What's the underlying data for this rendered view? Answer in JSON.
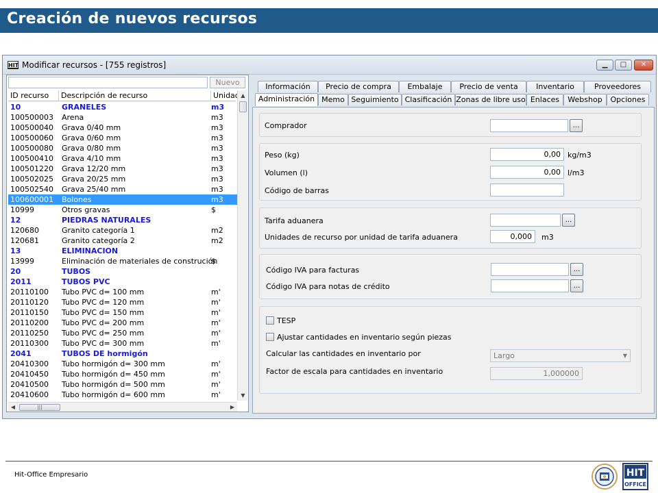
{
  "slide": {
    "title": "Creación de nuevos recursos"
  },
  "window": {
    "title": "Modificar recursos - [755 registros]",
    "app_icon": "HIT",
    "controls": {
      "minimize_icon": "minimize-icon",
      "maximize_icon": "maximize-icon",
      "close_icon": "close-icon"
    }
  },
  "list": {
    "search_value": "",
    "nuevo_label": "Nuevo",
    "headers": [
      "ID recurso",
      "Descripción de recurso",
      "Unidad"
    ],
    "rows": [
      {
        "id": "10",
        "desc": "GRANELES",
        "unit": "m3",
        "group": true
      },
      {
        "id": "100500003",
        "desc": "Arena",
        "unit": "m3"
      },
      {
        "id": "100500040",
        "desc": "Grava 0/40 mm",
        "unit": "m3"
      },
      {
        "id": "100500060",
        "desc": "Grava 0/60 mm",
        "unit": "m3"
      },
      {
        "id": "100500080",
        "desc": "Grava 0/80 mm",
        "unit": "m3"
      },
      {
        "id": "100500410",
        "desc": "Grava 4/10 mm",
        "unit": "m3"
      },
      {
        "id": "100501220",
        "desc": "Grava 12/20 mm",
        "unit": "m3"
      },
      {
        "id": "100502025",
        "desc": "Grava 20/25 mm",
        "unit": "m3"
      },
      {
        "id": "100502540",
        "desc": "Grava 25/40 mm",
        "unit": "m3"
      },
      {
        "id": "100600001",
        "desc": "Bolones",
        "unit": "m3",
        "selected": true
      },
      {
        "id": "10999",
        "desc": "Otros gravas",
        "unit": "$"
      },
      {
        "id": "12",
        "desc": "PIEDRAS NATURALES",
        "unit": "",
        "group": true
      },
      {
        "id": "120680",
        "desc": "Granito categoría 1",
        "unit": "m2"
      },
      {
        "id": "120681",
        "desc": "Granito categoría 2",
        "unit": "m2"
      },
      {
        "id": "13",
        "desc": "ELIMINACION",
        "unit": "",
        "group": true
      },
      {
        "id": "13999",
        "desc": "Eliminación de materiales de construción",
        "unit": "$"
      },
      {
        "id": "20",
        "desc": "TUBOS",
        "unit": "",
        "group": true
      },
      {
        "id": "2011",
        "desc": "TUBOS PVC",
        "unit": "",
        "group": true
      },
      {
        "id": "20110100",
        "desc": "Tubo PVC  d= 100 mm",
        "unit": "m'"
      },
      {
        "id": "20110120",
        "desc": "Tubo PVC  d= 120 mm",
        "unit": "m'"
      },
      {
        "id": "20110150",
        "desc": "Tubo PVC  d= 150 mm",
        "unit": "m'"
      },
      {
        "id": "20110200",
        "desc": "Tubo PVC  d= 200 mm",
        "unit": "m'"
      },
      {
        "id": "20110250",
        "desc": "Tubo PVC  d= 250 mm",
        "unit": "m'"
      },
      {
        "id": "20110300",
        "desc": "Tubo PVC  d= 300 mm",
        "unit": "m'"
      },
      {
        "id": "2041",
        "desc": "TUBOS DE hormigón",
        "unit": "",
        "group": true
      },
      {
        "id": "20410300",
        "desc": "Tubo hormigón  d= 300 mm",
        "unit": "m'"
      },
      {
        "id": "20410450",
        "desc": "Tubo hormigón  d= 450 mm",
        "unit": "m'"
      },
      {
        "id": "20410500",
        "desc": "Tubo hormigón  d= 500 mm",
        "unit": "m'"
      },
      {
        "id": "20410600",
        "desc": "Tubo hormigón  d= 600 mm",
        "unit": "m'"
      }
    ]
  },
  "tabs": {
    "row1": [
      "Información",
      "Precio de compra",
      "Embalaje",
      "Precio de venta",
      "Inventario",
      "Proveedores"
    ],
    "row2": [
      "Administración",
      "Memo",
      "Seguimiento",
      "Clasificación",
      "Zonas de libre uso",
      "Enlaces",
      "Webshop",
      "Opciones"
    ],
    "active": "Administración"
  },
  "form": {
    "comprador": {
      "label": "Comprador",
      "value": ""
    },
    "peso": {
      "label": "Peso (kg)",
      "value": "0,00",
      "unit": "kg/m3"
    },
    "volumen": {
      "label": "Volumen (l)",
      "value": "0,00",
      "unit": "l/m3"
    },
    "codigo_barras": {
      "label": "Código de barras",
      "value": ""
    },
    "tarifa_aduanera": {
      "label": "Tarifa aduanera",
      "value": ""
    },
    "unidades_tarifa": {
      "label": "Unidades de recurso por unidad de tarifa aduanera",
      "value": "0,000",
      "unit": "m3"
    },
    "iva_facturas": {
      "label": "Código IVA para facturas",
      "value": ""
    },
    "iva_notas": {
      "label": "Código IVA para notas de crédito",
      "value": ""
    },
    "tesp": {
      "label": "TESP",
      "checked": false
    },
    "ajustar": {
      "label": "Ajustar cantidades en inventario según piezas",
      "checked": false
    },
    "calcular": {
      "label": "Calcular las cantidades en inventario por",
      "value": "Largo"
    },
    "factor": {
      "label": "Factor de escala para cantidades en inventario",
      "value": "1,000000"
    },
    "dots_label": "..."
  },
  "footer": {
    "text": "Hit-Office Empresario",
    "logo_text_top": "HIT",
    "logo_text_bottom": "OFFICE"
  }
}
